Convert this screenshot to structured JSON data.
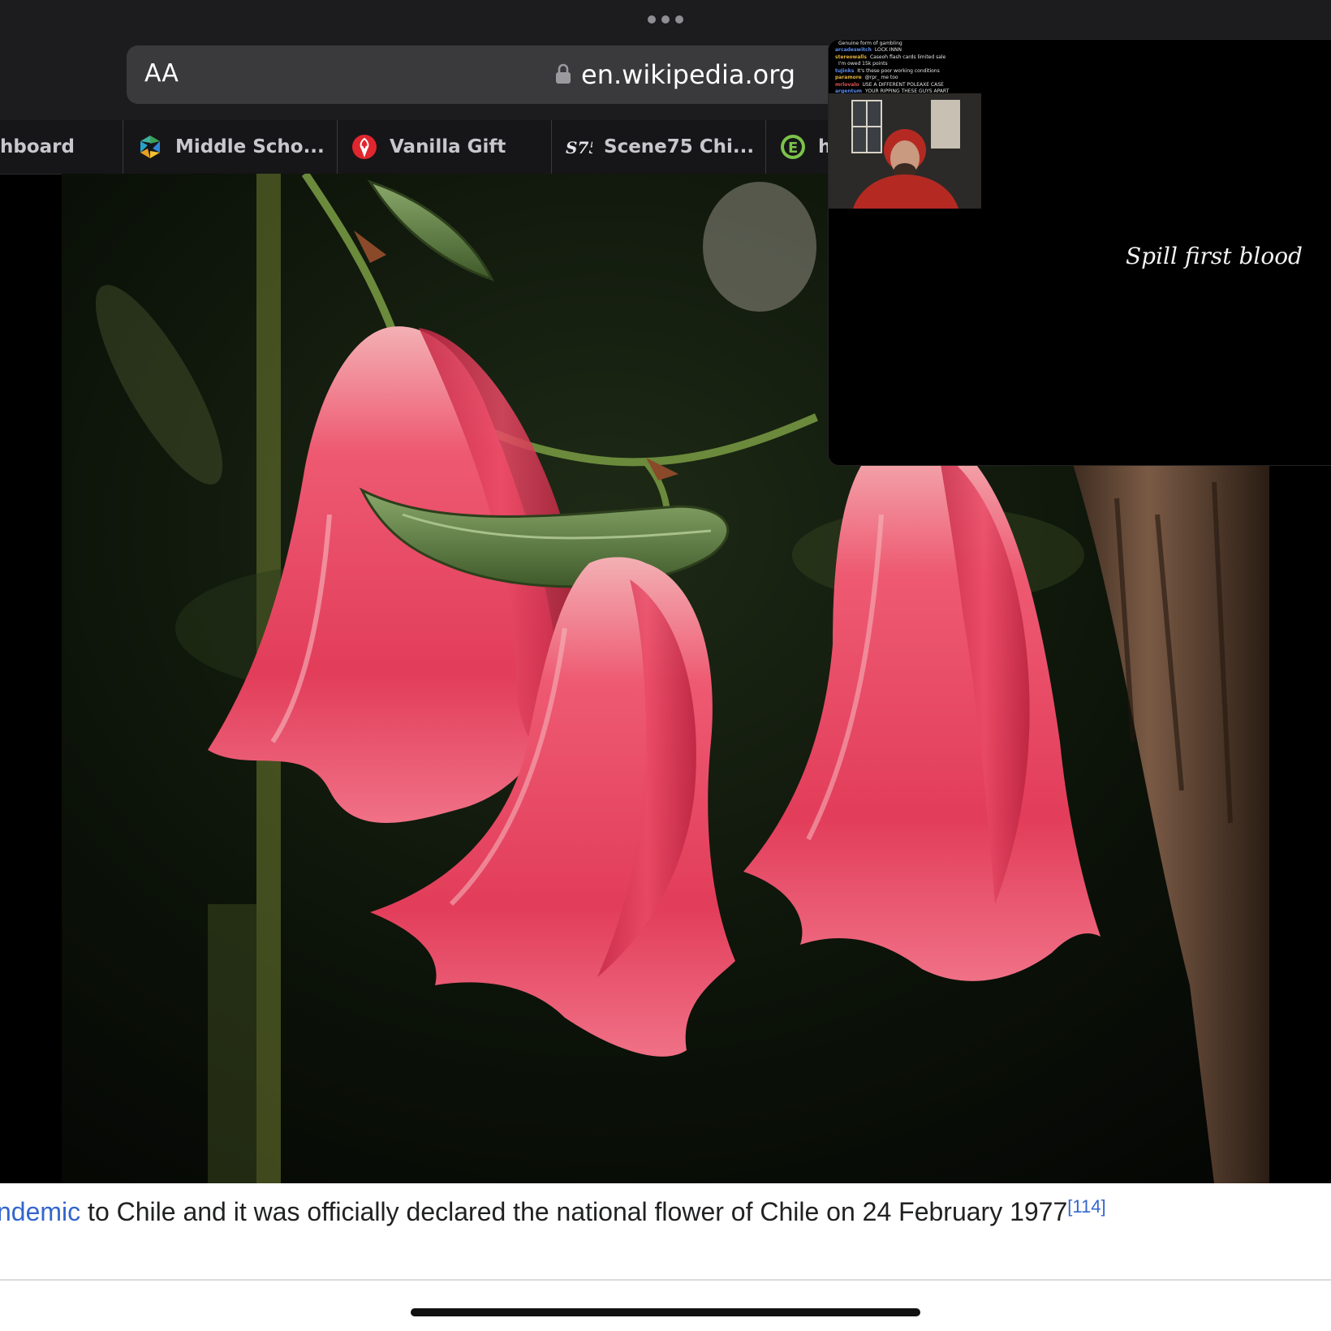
{
  "browser": {
    "reader_button": "AA",
    "address": "en.wikipedia.org"
  },
  "tabs": [
    {
      "label": "hboard",
      "icon": "dashboard-icon"
    },
    {
      "label": "Middle Scho...",
      "icon": "school-logo-icon"
    },
    {
      "label": "Vanilla Gift",
      "icon": "vanilla-gift-icon"
    },
    {
      "label": "Scene75 Chi...",
      "icon": "scene75-icon"
    },
    {
      "label": "h",
      "icon": "recycle-e-icon"
    }
  ],
  "caption": {
    "link_text": "ndemic",
    "text": " to Chile and it was officially declared the national flower of Chile on 24 February 1977",
    "reference": "[114]"
  },
  "pip": {
    "overlay_text": "Spill first blood",
    "chat": [
      {
        "user": "",
        "message": "Genuine form of gambling"
      },
      {
        "user": "arcadeswitch",
        "message": "LOCK INNN"
      },
      {
        "user": "stereowalls",
        "message": "Caseoh flash cards limited sale"
      },
      {
        "user": "",
        "message": "I'm owed 15k points"
      },
      {
        "user": "tuJinks",
        "message": "It's these poor working conditions"
      },
      {
        "user": "paramore",
        "message": "@rpr_ me too"
      },
      {
        "user": "mrlovalo",
        "message": "USE A DIFFERENT POLEAXE CASE"
      },
      {
        "user": "argentum",
        "message": "YOUR RIPPING THESE GUYS APART"
      }
    ]
  },
  "colors": {
    "chrome_bg": "#1c1c1e",
    "url_bar_bg": "#3a3a3c",
    "link": "#3366cc",
    "flower": "#e0405c"
  }
}
